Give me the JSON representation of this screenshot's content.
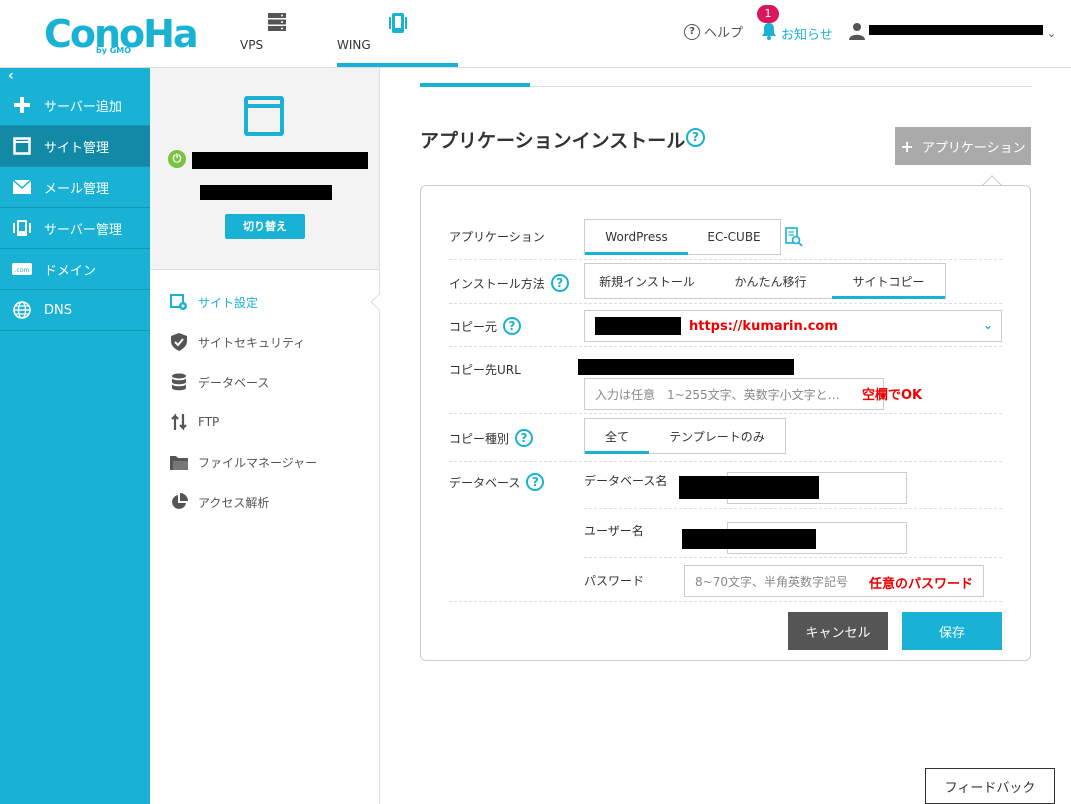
{
  "header": {
    "logo_text": "ConoHa",
    "logo_sub": "by GMO",
    "nav": [
      {
        "label": "VPS",
        "icon": "server-icon"
      },
      {
        "label": "WING",
        "icon": "phone-icon"
      }
    ],
    "help_label": "ヘルプ",
    "notice_label": "お知らせ",
    "notice_count": "1"
  },
  "sidebar": {
    "collapse_glyph": "‹",
    "items": [
      {
        "label": "サーバー追加",
        "icon": "plus-icon"
      },
      {
        "label": "サイト管理",
        "icon": "window-icon"
      },
      {
        "label": "メール管理",
        "icon": "mail-icon"
      },
      {
        "label": "サーバー管理",
        "icon": "server-manage-icon"
      },
      {
        "label": "ドメイン",
        "icon": "domain-icon"
      },
      {
        "label": "DNS",
        "icon": "globe-icon"
      }
    ]
  },
  "subpanel": {
    "switch_label": "切り替え",
    "items": [
      {
        "label": "サイト設定"
      },
      {
        "label": "サイトセキュリティ"
      },
      {
        "label": "データベース"
      },
      {
        "label": "FTP"
      },
      {
        "label": "ファイルマネージャー"
      },
      {
        "label": "アクセス解析"
      }
    ]
  },
  "main": {
    "title": "アプリケーションインストール",
    "add_app_label": "アプリケーション",
    "form": {
      "application_label": "アプリケーション",
      "application_options": [
        "WordPress",
        "EC-CUBE"
      ],
      "install_method_label": "インストール方法",
      "install_method_options": [
        "新規インストール",
        "かんたん移行",
        "サイトコピー"
      ],
      "copy_source_label": "コピー元",
      "copy_source_value": "https://kumarin.com",
      "copy_dest_label": "コピー先URL",
      "copy_dest_placeholder": "入力は任意　1~255文字、英数字小文字と…",
      "copy_dest_note": "空欄でOK",
      "copy_type_label": "コピー種別",
      "copy_type_options": [
        "全て",
        "テンプレートのみ"
      ],
      "database_label": "データベース",
      "db_name_label": "データベース名",
      "db_user_label": "ユーザー名",
      "password_label": "パスワード",
      "password_placeholder": "8~70文字、半角英数字記号",
      "password_note": "任意のパスワード"
    },
    "cancel_label": "キャンセル",
    "save_label": "保存",
    "feedback_label": "フィードバック"
  },
  "colors": {
    "accent": "#19b2d4",
    "note_red": "#e00000",
    "badge": "#d8175d"
  }
}
